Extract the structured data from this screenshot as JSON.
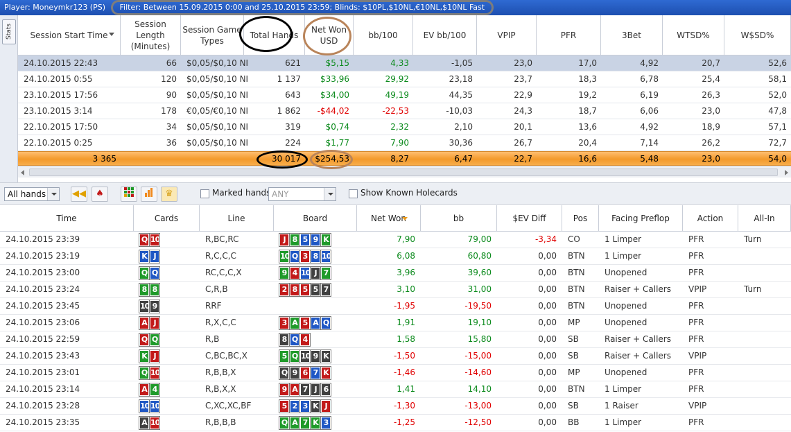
{
  "title_bar": {
    "player": "Player: Moneymkr123 (PS)",
    "filter": "Filter: Between 15.09.2015 0:00 and 25.10.2015 23:59; Blinds: $10PL,$10NL,€10NL,$10NL Fast"
  },
  "side_tab": {
    "label": "Stats"
  },
  "stats_table": {
    "headers": [
      "Session Start Time",
      "Session Length (Minutes)",
      "Session Game Types",
      "Total Hands",
      "Net Won USD",
      "bb/100",
      "EV bb/100",
      "VPIP",
      "PFR",
      "3Bet",
      "WTSD%",
      "W$SD%"
    ],
    "rows": [
      [
        "24.10.2015 22:43",
        "66",
        "$0,05/$0,10 NI",
        "621",
        "$5,15",
        "4,33",
        "-1,05",
        "23,0",
        "17,0",
        "4,92",
        "20,7",
        "52,6"
      ],
      [
        "24.10.2015 0:55",
        "120",
        "$0,05/$0,10 NI",
        "1 137",
        "$33,96",
        "29,92",
        "23,18",
        "23,7",
        "18,3",
        "6,78",
        "25,4",
        "58,1"
      ],
      [
        "23.10.2015 17:56",
        "90",
        "$0,05/$0,10 NI",
        "643",
        "$34,00",
        "49,19",
        "44,35",
        "22,9",
        "19,2",
        "6,19",
        "26,3",
        "52,0"
      ],
      [
        "23.10.2015 3:14",
        "178",
        "€0,05/€0,10 NI",
        "1 862",
        "-$44,02",
        "-22,53",
        "-10,03",
        "24,3",
        "18,7",
        "6,06",
        "23,0",
        "47,8"
      ],
      [
        "22.10.2015 17:50",
        "34",
        "$0,05/$0,10 NI",
        "319",
        "$0,74",
        "2,32",
        "2,10",
        "20,1",
        "13,6",
        "4,92",
        "18,9",
        "57,1"
      ],
      [
        "22.10.2015 0:25",
        "36",
        "$0,05/$0,10 NI",
        "224",
        "$1,77",
        "7,90",
        "30,36",
        "26,7",
        "20,4",
        "7,14",
        "26,2",
        "72,7"
      ]
    ],
    "totals": [
      "3 365",
      "",
      "",
      "30 017",
      "$254,53",
      "8,27",
      "6,47",
      "22,7",
      "16,6",
      "5,48",
      "23,0",
      "54,0"
    ],
    "selected_row": 0
  },
  "toolbar": {
    "hands_filter_value": "All hands",
    "marked_hands_label": "Marked hands",
    "marked_hands_value": "ANY",
    "show_holecards_label": "Show Known Holecards"
  },
  "hands_table": {
    "headers": [
      "Time",
      "Cards",
      "Line",
      "Board",
      "Net Won",
      "bb",
      "$EV Diff",
      "Pos",
      "Facing Preflop",
      "Action",
      "All-In"
    ],
    "rows": [
      {
        "time": "24.10.2015 23:39",
        "cards": [
          [
            "Q",
            "h"
          ],
          [
            "10",
            "h"
          ]
        ],
        "line": "R,BC,RC",
        "board": [
          [
            "J",
            "h"
          ],
          [
            "8",
            "c"
          ],
          [
            "5",
            "d"
          ],
          [
            "9",
            "d"
          ],
          [
            "K",
            "c"
          ]
        ],
        "net": "7,90",
        "bb": "79,00",
        "ev": "-3,34",
        "pos": "CO",
        "facing": "1 Limper",
        "action": "PFR",
        "allin": "Turn"
      },
      {
        "time": "24.10.2015 23:19",
        "cards": [
          [
            "K",
            "d"
          ],
          [
            "J",
            "d"
          ]
        ],
        "line": "R,C,C,C",
        "board": [
          [
            "10",
            "c"
          ],
          [
            "Q",
            "d"
          ],
          [
            "3",
            "h"
          ],
          [
            "8",
            "d"
          ],
          [
            "10",
            "d"
          ]
        ],
        "net": "6,08",
        "bb": "60,80",
        "ev": "0,00",
        "pos": "BTN",
        "facing": "1 Limper",
        "action": "PFR",
        "allin": ""
      },
      {
        "time": "24.10.2015 23:00",
        "cards": [
          [
            "Q",
            "c"
          ],
          [
            "Q",
            "d"
          ]
        ],
        "line": "RC,C,C,X",
        "board": [
          [
            "9",
            "c"
          ],
          [
            "4",
            "h"
          ],
          [
            "10",
            "d"
          ],
          [
            "J",
            "s"
          ],
          [
            "7",
            "c"
          ]
        ],
        "net": "3,96",
        "bb": "39,60",
        "ev": "0,00",
        "pos": "BTN",
        "facing": "Unopened",
        "action": "PFR",
        "allin": ""
      },
      {
        "time": "24.10.2015 23:24",
        "cards": [
          [
            "8",
            "c"
          ],
          [
            "8",
            "c"
          ]
        ],
        "line": "C,R,B",
        "board": [
          [
            "2",
            "h"
          ],
          [
            "8",
            "h"
          ],
          [
            "5",
            "h"
          ],
          [
            "5",
            "s"
          ],
          [
            "7",
            "s"
          ]
        ],
        "net": "3,10",
        "bb": "31,00",
        "ev": "0,00",
        "pos": "BTN",
        "facing": "Raiser + Callers",
        "action": "VPIP",
        "allin": "Turn"
      },
      {
        "time": "24.10.2015 23:45",
        "cards": [
          [
            "10",
            "s"
          ],
          [
            "9",
            "s"
          ]
        ],
        "line": "RRF",
        "board": [],
        "net": "-1,95",
        "bb": "-19,50",
        "ev": "0,00",
        "pos": "BTN",
        "facing": "Unopened",
        "action": "PFR",
        "allin": ""
      },
      {
        "time": "24.10.2015 23:06",
        "cards": [
          [
            "A",
            "h"
          ],
          [
            "J",
            "h"
          ]
        ],
        "line": "R,X,C,C",
        "board": [
          [
            "3",
            "h"
          ],
          [
            "A",
            "c"
          ],
          [
            "5",
            "h"
          ],
          [
            "A",
            "d"
          ],
          [
            "Q",
            "d"
          ]
        ],
        "net": "1,91",
        "bb": "19,10",
        "ev": "0,00",
        "pos": "MP",
        "facing": "Unopened",
        "action": "PFR",
        "allin": ""
      },
      {
        "time": "24.10.2015 22:59",
        "cards": [
          [
            "Q",
            "h"
          ],
          [
            "Q",
            "c"
          ]
        ],
        "line": "R,B",
        "board": [
          [
            "8",
            "s"
          ],
          [
            "Q",
            "d"
          ],
          [
            "4",
            "h"
          ]
        ],
        "net": "1,58",
        "bb": "15,80",
        "ev": "0,00",
        "pos": "SB",
        "facing": "Raiser + Callers",
        "action": "PFR",
        "allin": ""
      },
      {
        "time": "24.10.2015 23:43",
        "cards": [
          [
            "K",
            "c"
          ],
          [
            "J",
            "h"
          ]
        ],
        "line": "C,BC,BC,X",
        "board": [
          [
            "5",
            "c"
          ],
          [
            "Q",
            "c"
          ],
          [
            "10",
            "s"
          ],
          [
            "9",
            "s"
          ],
          [
            "K",
            "s"
          ]
        ],
        "net": "-1,50",
        "bb": "-15,00",
        "ev": "0,00",
        "pos": "SB",
        "facing": "Raiser + Callers",
        "action": "VPIP",
        "allin": ""
      },
      {
        "time": "24.10.2015 23:01",
        "cards": [
          [
            "Q",
            "c"
          ],
          [
            "10",
            "h"
          ]
        ],
        "line": "R,B,B,X",
        "board": [
          [
            "Q",
            "s"
          ],
          [
            "9",
            "s"
          ],
          [
            "6",
            "h"
          ],
          [
            "7",
            "d"
          ],
          [
            "K",
            "h"
          ]
        ],
        "net": "-1,46",
        "bb": "-14,60",
        "ev": "0,00",
        "pos": "MP",
        "facing": "Unopened",
        "action": "PFR",
        "allin": ""
      },
      {
        "time": "24.10.2015 23:14",
        "cards": [
          [
            "A",
            "h"
          ],
          [
            "4",
            "c"
          ]
        ],
        "line": "R,B,X,X",
        "board": [
          [
            "9",
            "h"
          ],
          [
            "A",
            "h"
          ],
          [
            "7",
            "s"
          ],
          [
            "J",
            "s"
          ],
          [
            "6",
            "s"
          ]
        ],
        "net": "1,41",
        "bb": "14,10",
        "ev": "0,00",
        "pos": "BTN",
        "facing": "1 Limper",
        "action": "PFR",
        "allin": ""
      },
      {
        "time": "24.10.2015 23:28",
        "cards": [
          [
            "10",
            "d"
          ],
          [
            "10",
            "d"
          ]
        ],
        "line": "C,XC,XC,BF",
        "board": [
          [
            "5",
            "h"
          ],
          [
            "2",
            "d"
          ],
          [
            "3",
            "d"
          ],
          [
            "K",
            "s"
          ],
          [
            "J",
            "h"
          ]
        ],
        "net": "-1,30",
        "bb": "-13,00",
        "ev": "0,00",
        "pos": "SB",
        "facing": "1 Raiser",
        "action": "VPIP",
        "allin": ""
      },
      {
        "time": "24.10.2015 23:35",
        "cards": [
          [
            "A",
            "s"
          ],
          [
            "10",
            "h"
          ]
        ],
        "line": "R,B,B,B",
        "board": [
          [
            "Q",
            "c"
          ],
          [
            "A",
            "c"
          ],
          [
            "7",
            "c"
          ],
          [
            "K",
            "c"
          ],
          [
            "3",
            "d"
          ]
        ],
        "net": "-1,25",
        "bb": "-12,50",
        "ev": "0,00",
        "pos": "BB",
        "facing": "1 Limper",
        "action": "PFR",
        "allin": ""
      }
    ]
  },
  "colors": {
    "title_bar": "#1d4fb0",
    "positive": "#0b8a1c",
    "negative": "#e00000",
    "totals_row": "#f39a2c",
    "selected_row": "#c9d3e4",
    "annotation_black": "#000000",
    "annotation_brown": "#b9845a",
    "annotation_gray": "#7d7d7d"
  },
  "icons": [
    "rewind-icon",
    "cards-icon",
    "grid-report-icon",
    "bar-chart-icon",
    "trophy-icon",
    "dropdown-arrow-icon",
    "sort-arrow-icon"
  ]
}
